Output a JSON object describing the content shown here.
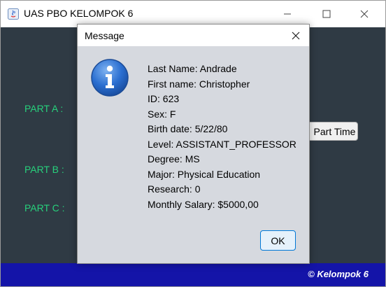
{
  "window": {
    "title": "UAS PBO KELOMPOK 6",
    "controls": [
      "minimize-icon",
      "maximize-icon",
      "close-icon"
    ]
  },
  "main": {
    "part_a_label": "PART A :",
    "part_b_label": "PART B :",
    "part_c_label": "PART C :",
    "part_time_button": "Part Time"
  },
  "footer": {
    "text": "© Kelompok 6"
  },
  "dialog": {
    "title": "Message",
    "icon": "info-icon",
    "lines": [
      "Last Name: Andrade",
      "First name: Christopher",
      "ID: 623",
      "Sex: F",
      "Birth date: 5/22/80",
      "Level: ASSISTANT_PROFESSOR",
      "Degree: MS",
      "Major: Physical Education",
      "Research: 0",
      "Monthly Salary: $5000,00"
    ],
    "ok_label": "OK"
  },
  "colors": {
    "background": "#2f3a44",
    "label_green": "#27d17c",
    "footer_blue": "#1414a8",
    "dialog_bg": "#d6d9df",
    "ok_border": "#0078d7"
  }
}
